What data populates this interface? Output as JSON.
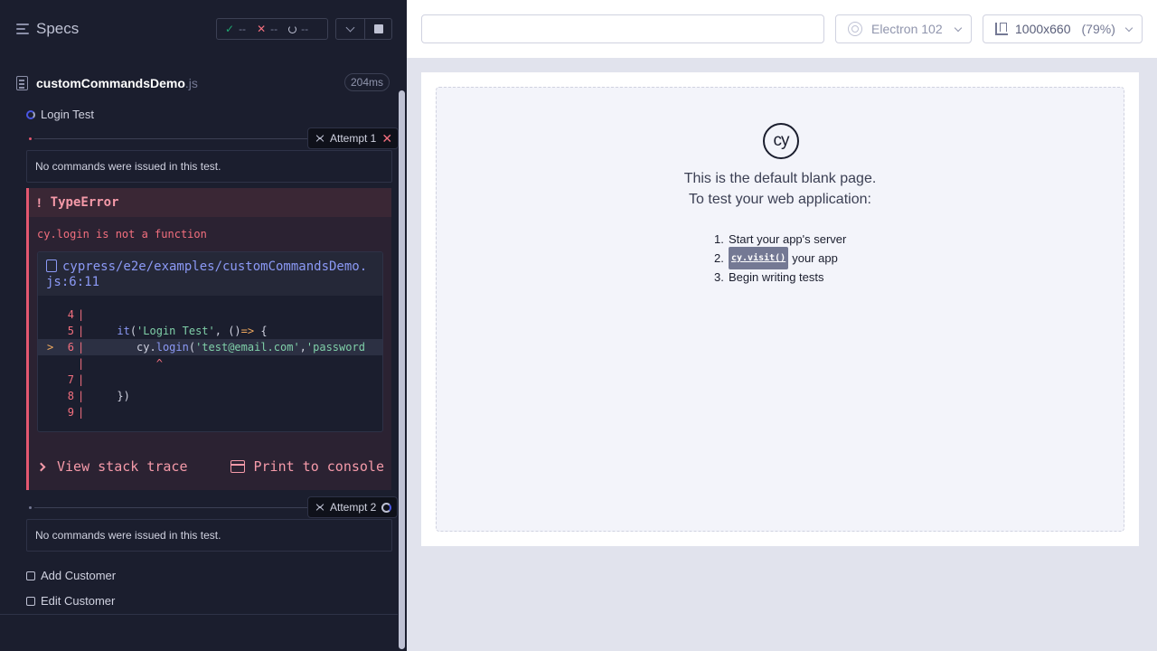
{
  "reporter": {
    "header": {
      "title": "Specs",
      "passed": "--",
      "failed": "--",
      "pending": "--"
    },
    "spec": {
      "name": "customCommandsDemo",
      "ext": ".js",
      "duration": "204ms"
    },
    "tests": [
      {
        "title": "Login Test",
        "state": "running",
        "attempts": [
          {
            "label": "Attempt 1",
            "state": "failed",
            "no_commands": "No commands were issued in this test.",
            "error": {
              "name": "TypeError",
              "message": "cy.login is not a function",
              "file_line1": "cypress/e2e/examples/customCommandsDemo.",
              "file_line2": "js:6:11",
              "view_stack_trace": "View stack trace",
              "print_to_console": "Print to console"
            }
          },
          {
            "label": "Attempt 2",
            "state": "running",
            "no_commands": "No commands were issued in this test."
          }
        ]
      },
      {
        "title": "Add Customer",
        "state": "pending"
      },
      {
        "title": "Edit Customer",
        "state": "pending"
      }
    ],
    "code_frame": {
      "lines": [
        {
          "num": "4",
          "code": ""
        },
        {
          "num": "5",
          "code": "it('Login Test', ()=> {"
        },
        {
          "num": "6",
          "code": "cy.login('test@email.com','password"
        },
        {
          "num": "",
          "code": "^"
        },
        {
          "num": "7",
          "code": ""
        },
        {
          "num": "8",
          "code": "})"
        },
        {
          "num": "9",
          "code": ""
        }
      ],
      "highlight_marker": ">"
    }
  },
  "toolbar": {
    "url_value": "",
    "browser": "Electron 102",
    "viewport": "1000x660",
    "scale": "(79%)"
  },
  "blank_page": {
    "line1": "This is the default blank page.",
    "line2": "To test your web application:",
    "logo_text": "cy",
    "steps": [
      {
        "num": "1.",
        "text": "Start your app's server"
      },
      {
        "num": "2.",
        "chip": "cy.visit()",
        "text": "your app"
      },
      {
        "num": "3.",
        "text": "Begin writing tests"
      }
    ]
  },
  "colors": {
    "reporter_bg": "#1b1e2e",
    "error_accent": "#e45770",
    "pass": "#1fa971",
    "fail": "#f36f7e",
    "link": "#8b99f5"
  }
}
